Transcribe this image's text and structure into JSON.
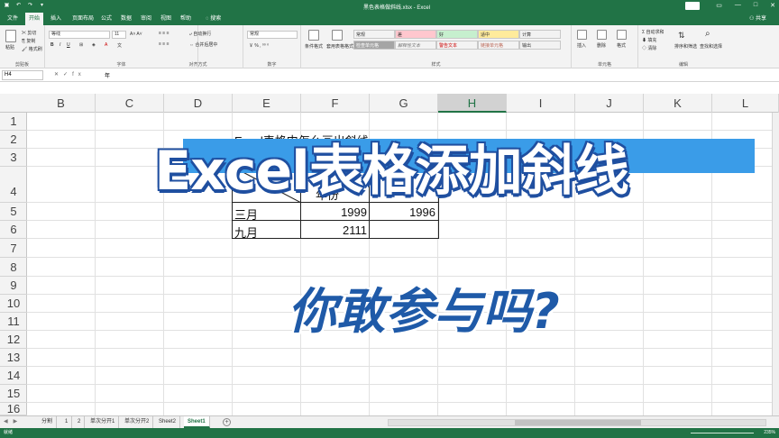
{
  "window": {
    "title": "黑色表格做斜线.xlsx - Excel",
    "signin_label": "登录",
    "share_label": "共享"
  },
  "tabs": [
    {
      "label": "文件"
    },
    {
      "label": "开始",
      "active": true
    },
    {
      "label": "插入"
    },
    {
      "label": "页面布局"
    },
    {
      "label": "公式"
    },
    {
      "label": "数据"
    },
    {
      "label": "审阅"
    },
    {
      "label": "视图"
    },
    {
      "label": "帮助"
    },
    {
      "label": "搜索"
    }
  ],
  "ribbon": {
    "groups": [
      "剪贴板",
      "字体",
      "对齐方式",
      "数字",
      "样式",
      "单元格",
      "编辑"
    ],
    "clipboard": {
      "paste": "粘贴",
      "cut": "剪切",
      "copy": "复制",
      "format_painter": "格式刷"
    },
    "font": {
      "name": "等线",
      "size": "11"
    },
    "alignment": {
      "wrap": "自动换行",
      "merge": "合并后居中"
    },
    "number": {
      "format": "常规"
    },
    "styles": {
      "conditional": "条件格式",
      "table": "套用表格格式",
      "cells": [
        {
          "label": "常规",
          "bg": "#ffffff"
        },
        {
          "label": "差",
          "bg": "#ffc7ce"
        },
        {
          "label": "好",
          "bg": "#c6efce"
        },
        {
          "label": "适中",
          "bg": "#ffeb9c"
        },
        {
          "label": "计算",
          "bg": "#f2f2f2"
        },
        {
          "label": "检查单元格",
          "bg": "#a5a5a5"
        },
        {
          "label": "解释性文本",
          "bg": "#ffffff"
        },
        {
          "label": "警告文本",
          "bg": "#ffffff"
        },
        {
          "label": "链接单元格",
          "bg": "#ffffff"
        },
        {
          "label": "输出",
          "bg": "#f2f2f2"
        }
      ]
    },
    "cells_group": {
      "insert": "插入",
      "delete": "删除",
      "format": "格式"
    },
    "editing": {
      "autosum": "自动求和",
      "fill": "填充",
      "clear": "清除",
      "sort": "排序和筛选",
      "find": "查找和选择"
    }
  },
  "formula_bar": {
    "name_box": "H4",
    "value": "年"
  },
  "columns": [
    "B",
    "C",
    "D",
    "E",
    "F",
    "G",
    "H",
    "I",
    "J",
    "K",
    "L"
  ],
  "selected_column": "H",
  "rows": [
    "1",
    "2",
    "3",
    "4",
    "5",
    "6",
    "7",
    "8",
    "9",
    "10",
    "11",
    "12",
    "13",
    "14",
    "15",
    "16"
  ],
  "cells": {
    "e2": "Excel表格中怎么画出斜线",
    "f4": "年份",
    "e5": "三月",
    "f5": "1999",
    "g5": "1996",
    "e6": "九月",
    "f6": "2111"
  },
  "overlay": {
    "headline": "Excel表格添加斜线",
    "subline": "你敢参与吗?",
    "banner_color": "#3a9ce8",
    "headline_color": "#ffffff",
    "outline_color": "#1f4fa0",
    "subline_color": "#1f5aa8"
  },
  "sheet_tabs": [
    {
      "label": "分割"
    },
    {
      "label": "1"
    },
    {
      "label": "2"
    },
    {
      "label": "单次分开1"
    },
    {
      "label": "单次分开2"
    },
    {
      "label": "Sheet2"
    },
    {
      "label": "Sheet1",
      "active": true
    }
  ],
  "status": {
    "ready": "就绪",
    "zoom": "235%"
  },
  "accent_color": "#217346"
}
